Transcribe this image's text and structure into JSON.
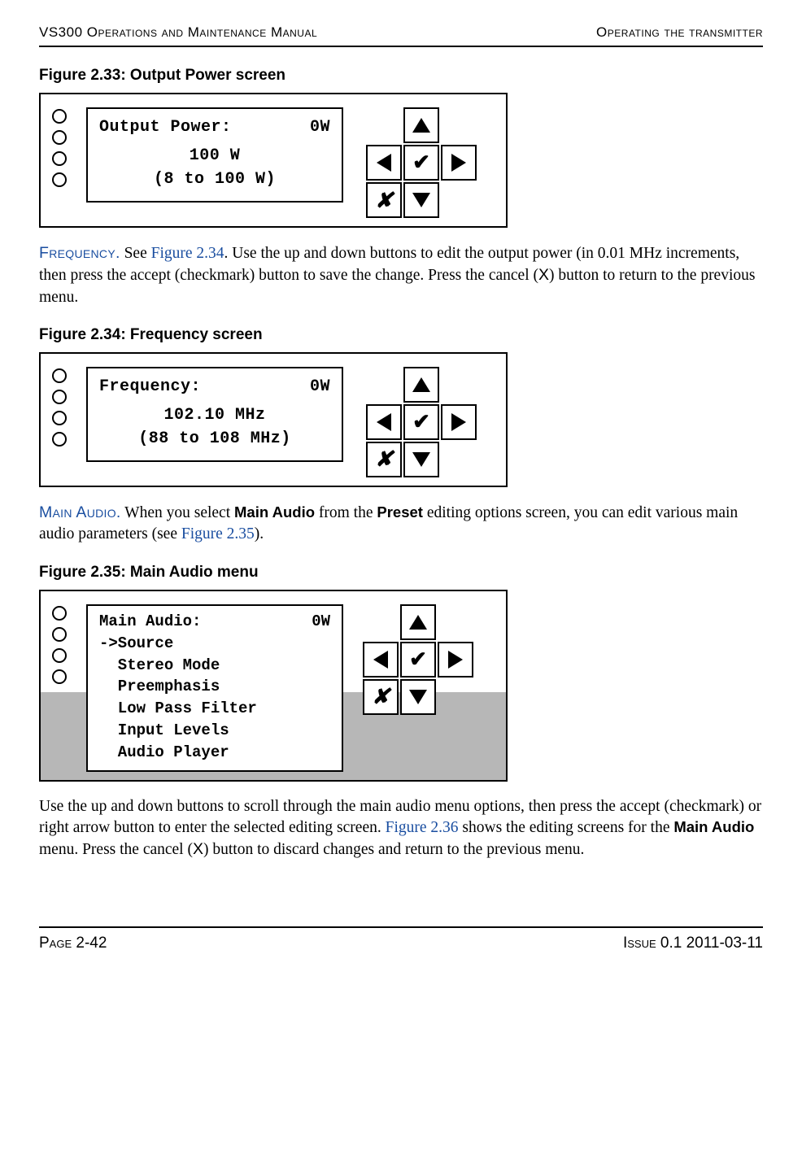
{
  "header": {
    "left": "VS300 Operations and Maintenance Manual",
    "right": "Operating the transmitter"
  },
  "figure233": {
    "title": "Figure 2.33: Output Power screen",
    "lcd": {
      "row1_left": "Output Power:",
      "row1_right": "0W",
      "row2": "100 W",
      "row3": "(8 to 100 W)"
    }
  },
  "para_frequency": {
    "lead": "Frequency.",
    "text_before_link": " See ",
    "link": "Figure 2.34",
    "text_after": ". Use the up and down buttons to edit the output power (in 0.01 MHz increments, then press the accept (checkmark) button to save the change. Press the cancel (",
    "x": "X",
    "text_end": ") button to return to the previous menu."
  },
  "figure234": {
    "title": "Figure 2.34: Frequency screen",
    "lcd": {
      "row1_left": "Frequency:",
      "row1_right": "0W",
      "row2": "102.10 MHz",
      "row3": "(88 to 108 MHz)"
    }
  },
  "para_mainaudio": {
    "lead": "Main Audio.",
    "t1": " When you select ",
    "b1": "Main Audio",
    "t2": " from the ",
    "b2": "Preset",
    "t3": " editing options screen, you can edit various main audio parameters (see ",
    "link": "Figure 2.35",
    "t4": ")."
  },
  "figure235": {
    "title": "Figure 2.35: Main Audio menu",
    "lcd": {
      "header_left": "Main Audio:",
      "header_right": "0W",
      "items": [
        "->Source",
        "  Stereo Mode",
        "  Preemphasis",
        "  Low Pass Filter",
        "  Input Levels",
        "  Audio Player"
      ]
    }
  },
  "para_after235": {
    "t1": "Use the up and down buttons to scroll through the main audio menu options, then press the accept (checkmark) or right arrow button to enter the selected editing screen. ",
    "link": "Figure 2.36",
    "t2": " shows the editing screens for the ",
    "b1": "Main Audio",
    "t3": " menu. Press the cancel (",
    "x": "X",
    "t4": ") button to discard changes and return to the previous menu."
  },
  "footer": {
    "left": "Page 2-42",
    "right": "Issue 0.1  2011-03-11"
  },
  "icons": {
    "check": "✔",
    "x": "✘"
  }
}
